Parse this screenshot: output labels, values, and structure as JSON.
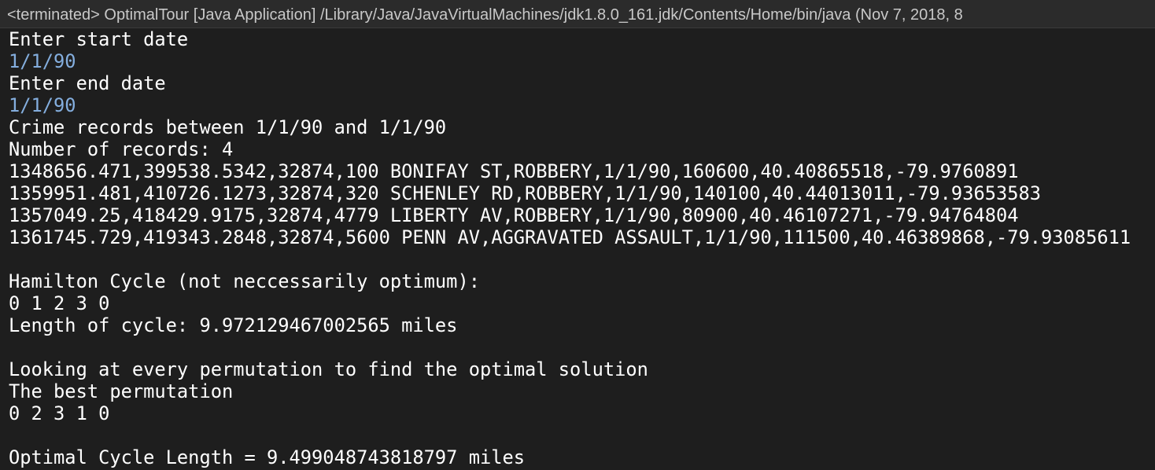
{
  "console": {
    "header_title": "<terminated> OptimalTour [Java Application] /Library/Java/JavaVirtualMachines/jdk1.8.0_161.jdk/Contents/Home/bin/java (Nov 7, 2018, 8",
    "lines": [
      {
        "text": "Enter start date",
        "type": "output"
      },
      {
        "text": "1/1/90",
        "type": "input"
      },
      {
        "text": "Enter end date",
        "type": "output"
      },
      {
        "text": "1/1/90",
        "type": "input"
      },
      {
        "text": "Crime records between 1/1/90 and 1/1/90",
        "type": "output"
      },
      {
        "text": "Number of records: 4",
        "type": "output"
      },
      {
        "text": "1348656.471,399538.5342,32874,100 BONIFAY ST,ROBBERY,1/1/90,160600,40.40865518,-79.9760891",
        "type": "output"
      },
      {
        "text": "1359951.481,410726.1273,32874,320 SCHENLEY RD,ROBBERY,1/1/90,140100,40.44013011,-79.93653583",
        "type": "output"
      },
      {
        "text": "1357049.25,418429.9175,32874,4779 LIBERTY AV,ROBBERY,1/1/90,80900,40.46107271,-79.94764804",
        "type": "output"
      },
      {
        "text": "1361745.729,419343.2848,32874,5600 PENN AV,AGGRAVATED ASSAULT,1/1/90,111500,40.46389868,-79.93085611",
        "type": "output"
      },
      {
        "text": "",
        "type": "output"
      },
      {
        "text": "Hamilton Cycle (not neccessarily optimum):",
        "type": "output"
      },
      {
        "text": "0 1 2 3 0",
        "type": "output"
      },
      {
        "text": "Length of cycle: 9.972129467002565 miles",
        "type": "output"
      },
      {
        "text": "",
        "type": "output"
      },
      {
        "text": "Looking at every permutation to find the optimal solution",
        "type": "output"
      },
      {
        "text": "The best permutation",
        "type": "output"
      },
      {
        "text": "0 2 3 1 0",
        "type": "output"
      },
      {
        "text": "",
        "type": "output"
      },
      {
        "text": "Optimal Cycle Length = 9.499048743818797 miles",
        "type": "output"
      }
    ]
  },
  "colors": {
    "background": "#1e1e1e",
    "output_text": "#ffffff",
    "input_text": "#84aede",
    "header_text": "#c8c8c8"
  }
}
